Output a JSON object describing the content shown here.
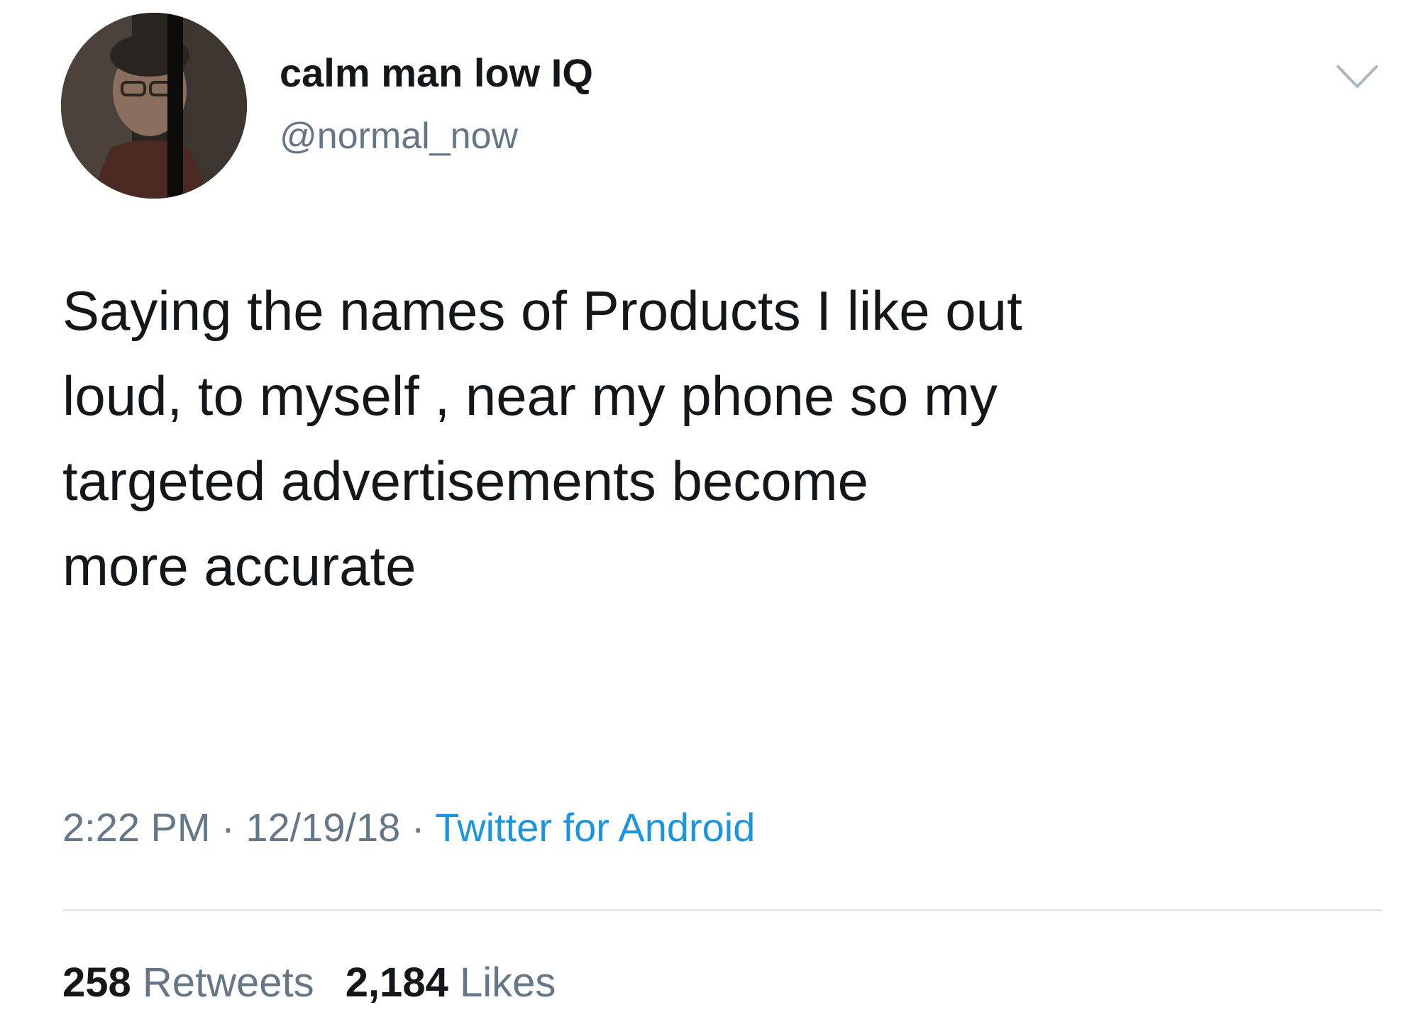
{
  "author": {
    "display_name": "calm man low IQ",
    "handle": "@normal_now"
  },
  "tweet": {
    "text_lines": [
      "Saying the names of Products I like out",
      "loud, to myself , near my phone so my",
      "targeted advertisements become",
      "more accurate"
    ],
    "time": "2:22 PM",
    "date": "12/19/18",
    "separator": " · ",
    "source": "Twitter for Android"
  },
  "stats": {
    "retweets_count": "258",
    "retweets_label": "Retweets",
    "likes_count": "2,184",
    "likes_label": "Likes"
  },
  "icons": {
    "menu": "chevron-down-icon"
  },
  "colors": {
    "text": "#14171a",
    "secondary": "#657786",
    "link": "#1b95e0",
    "divider": "#e1e8ed"
  }
}
